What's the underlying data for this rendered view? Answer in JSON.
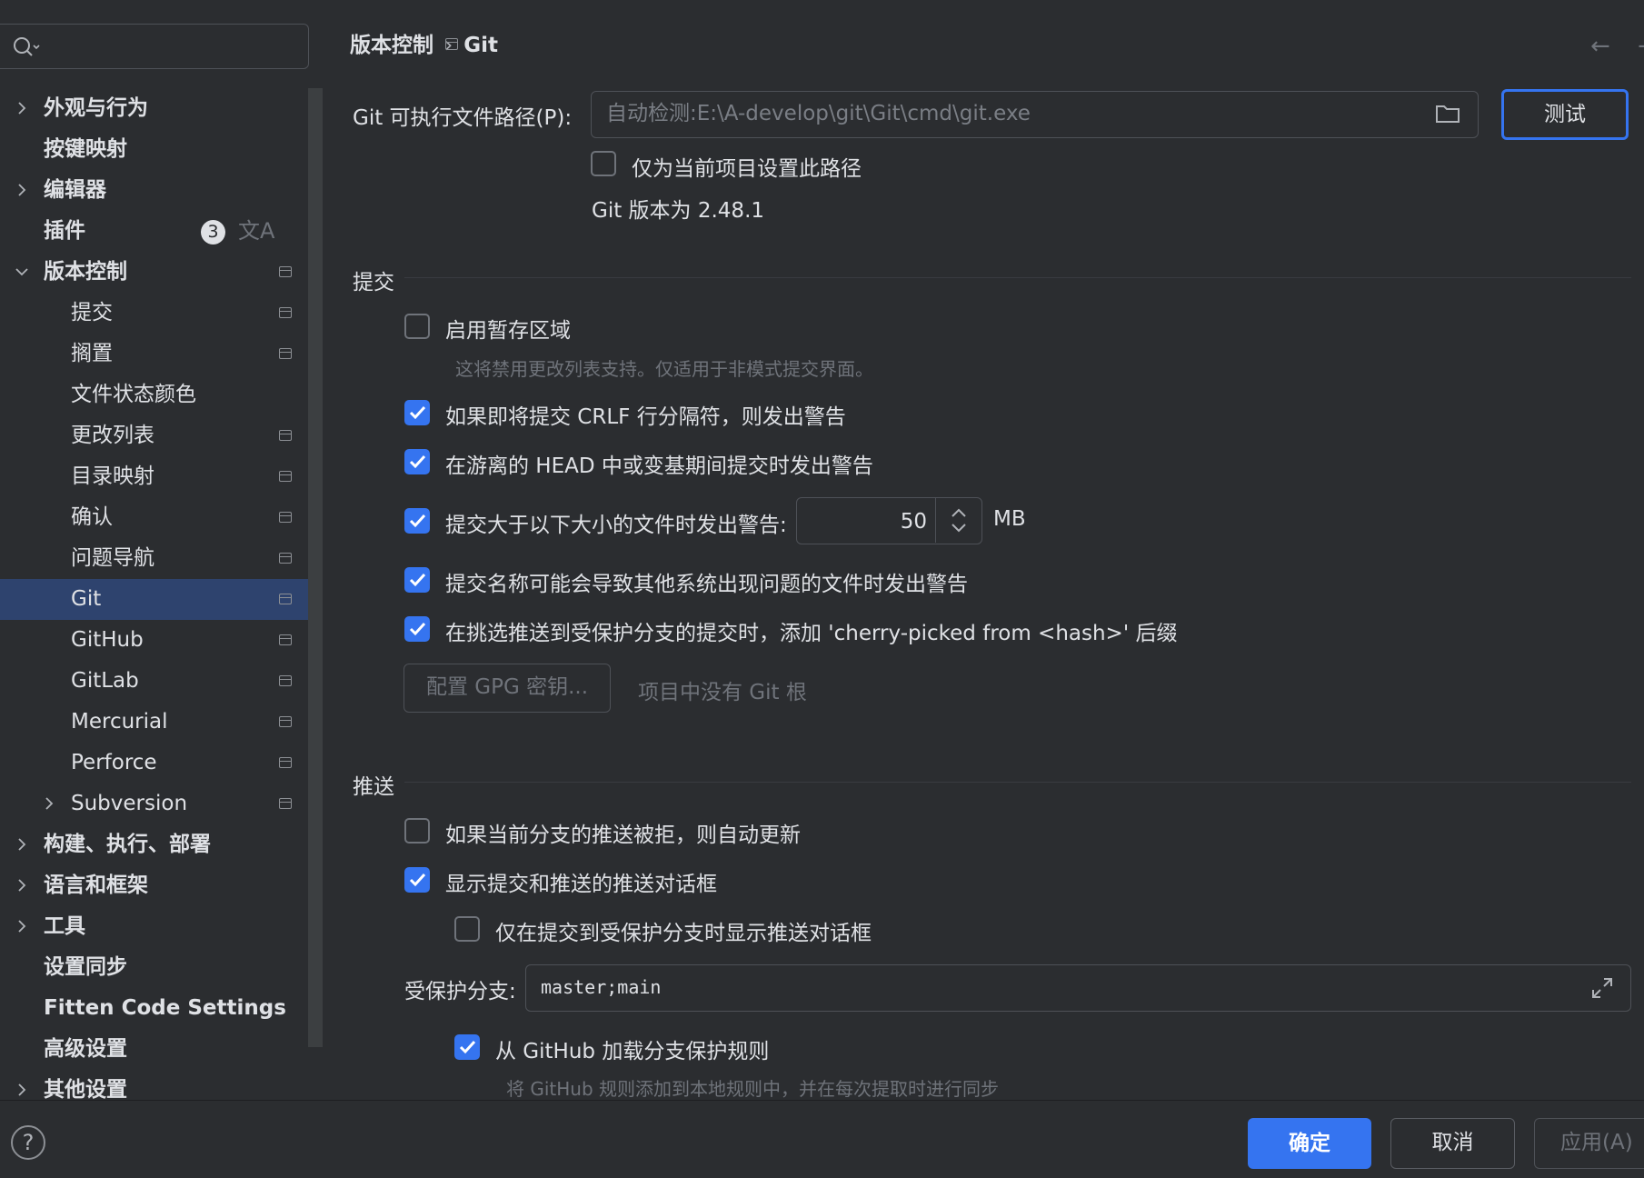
{
  "search": {
    "placeholder": ""
  },
  "sidebar": {
    "items": [
      {
        "label": "外观与行为",
        "level": 0,
        "bold": true,
        "chevron": "right",
        "pin": false
      },
      {
        "label": "按键映射",
        "level": 0,
        "bold": true,
        "chevron": "",
        "pin": false
      },
      {
        "label": "编辑器",
        "level": 0,
        "bold": true,
        "chevron": "right",
        "pin": false
      },
      {
        "label": "插件",
        "level": 0,
        "bold": true,
        "chevron": "",
        "pin": false,
        "badge": "3",
        "translate_icon": "文A"
      },
      {
        "label": "版本控制",
        "level": 0,
        "bold": true,
        "chevron": "down",
        "pin": true
      },
      {
        "label": "提交",
        "level": 1,
        "bold": false,
        "chevron": "",
        "pin": true
      },
      {
        "label": "搁置",
        "level": 1,
        "bold": false,
        "chevron": "",
        "pin": true
      },
      {
        "label": "文件状态颜色",
        "level": 1,
        "bold": false,
        "chevron": "",
        "pin": false
      },
      {
        "label": "更改列表",
        "level": 1,
        "bold": false,
        "chevron": "",
        "pin": true
      },
      {
        "label": "目录映射",
        "level": 1,
        "bold": false,
        "chevron": "",
        "pin": true
      },
      {
        "label": "确认",
        "level": 1,
        "bold": false,
        "chevron": "",
        "pin": true
      },
      {
        "label": "问题导航",
        "level": 1,
        "bold": false,
        "chevron": "",
        "pin": true
      },
      {
        "label": "Git",
        "level": 1,
        "bold": false,
        "chevron": "",
        "pin": true,
        "selected": true
      },
      {
        "label": "GitHub",
        "level": 1,
        "bold": false,
        "chevron": "",
        "pin": true
      },
      {
        "label": "GitLab",
        "level": 1,
        "bold": false,
        "chevron": "",
        "pin": true
      },
      {
        "label": "Mercurial",
        "level": 1,
        "bold": false,
        "chevron": "",
        "pin": true
      },
      {
        "label": "Perforce",
        "level": 1,
        "bold": false,
        "chevron": "",
        "pin": true
      },
      {
        "label": "Subversion",
        "level": 1,
        "bold": false,
        "chevron": "right",
        "pin": true
      },
      {
        "label": "构建、执行、部署",
        "level": 0,
        "bold": true,
        "chevron": "right",
        "pin": false
      },
      {
        "label": "语言和框架",
        "level": 0,
        "bold": true,
        "chevron": "right",
        "pin": false
      },
      {
        "label": "工具",
        "level": 0,
        "bold": true,
        "chevron": "right",
        "pin": false
      },
      {
        "label": "设置同步",
        "level": 0,
        "bold": true,
        "chevron": "",
        "pin": false
      },
      {
        "label": "Fitten Code Settings",
        "level": 0,
        "bold": true,
        "chevron": "",
        "pin": false
      },
      {
        "label": "高级设置",
        "level": 0,
        "bold": true,
        "chevron": "",
        "pin": false
      },
      {
        "label": "其他设置",
        "level": 0,
        "bold": true,
        "chevron": "right",
        "pin": false
      }
    ]
  },
  "breadcrumb": {
    "parent": "版本控制",
    "separator": "›",
    "current": "Git"
  },
  "nav": {
    "back": "←",
    "forward": "→"
  },
  "git_path": {
    "label": "Git 可执行文件路径(P):",
    "value": "自动检测:E:\\A-develop\\git\\Git\\cmd\\git.exe",
    "test_button": "测试",
    "project_only_label": "仅为当前项目设置此路径",
    "project_only_checked": false,
    "version_text": "Git 版本为 2.48.1"
  },
  "commit_section": {
    "title": "提交",
    "staging_label": "启用暂存区域",
    "staging_checked": false,
    "staging_hint": "这将禁用更改列表支持。仅适用于非模式提交界面。",
    "crlf_label": "如果即将提交 CRLF 行分隔符，则发出警告",
    "crlf_checked": true,
    "detached_label": "在游离的 HEAD 中或变基期间提交时发出警告",
    "detached_checked": true,
    "large_file_label": "提交大于以下大小的文件时发出警告:",
    "large_file_checked": true,
    "large_file_value": "50",
    "large_file_unit": "MB",
    "bad_names_label": "提交名称可能会导致其他系统出现问题的文件时发出警告",
    "bad_names_checked": true,
    "cherry_label": "在挑选推送到受保护分支的提交时，添加 'cherry-picked from <hash>' 后缀",
    "cherry_checked": true,
    "gpg_button": "配置 GPG 密钥...",
    "gpg_note": "项目中没有 Git 根"
  },
  "push_section": {
    "title": "推送",
    "auto_update_label": "如果当前分支的推送被拒，则自动更新",
    "auto_update_checked": false,
    "show_dialog_label": "显示提交和推送的推送对话框",
    "show_dialog_checked": true,
    "protected_only_label": "仅在提交到受保护分支时显示推送对话框",
    "protected_only_checked": false,
    "protected_branches_label": "受保护分支:",
    "protected_branches_value": "master;main",
    "github_rules_label": "从 GitHub 加载分支保护规则",
    "github_rules_checked": true,
    "github_rules_hint": "将 GitHub 规则添加到本地规则中，并在每次提取时进行同步"
  },
  "footer": {
    "help": "?",
    "ok": "确定",
    "cancel": "取消",
    "apply": "应用(A)"
  },
  "colors": {
    "background": "#2b2d30",
    "accent": "#3574f0",
    "selection": "#2e436e",
    "text": "#dfe1e5",
    "muted": "#6f737a"
  }
}
